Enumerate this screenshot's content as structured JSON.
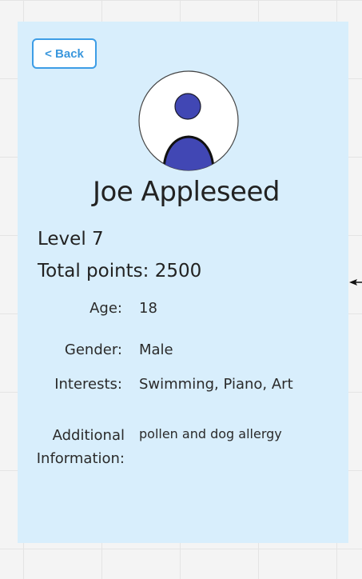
{
  "back_button": {
    "label": "< Back"
  },
  "profile": {
    "name": "Joe Appleseed",
    "level": "Level 7",
    "total_points": "Total points: 2500"
  },
  "fields": {
    "age": {
      "label": "Age:",
      "value": "18"
    },
    "gender": {
      "label": "Gender:",
      "value": "Male"
    },
    "interests": {
      "label": "Interests:",
      "value": "Swimming, Piano, Art"
    },
    "additional": {
      "label_line1": "Additional",
      "label_line2": "Information:",
      "value": "pollen and dog allergy"
    }
  },
  "colors": {
    "card_background": "#d8eefc",
    "accent_blue": "#3d9de6",
    "avatar_fill": "#4147b4"
  },
  "icons": {
    "avatar": "user-avatar-icon",
    "connector": "arrow-left-icon"
  }
}
